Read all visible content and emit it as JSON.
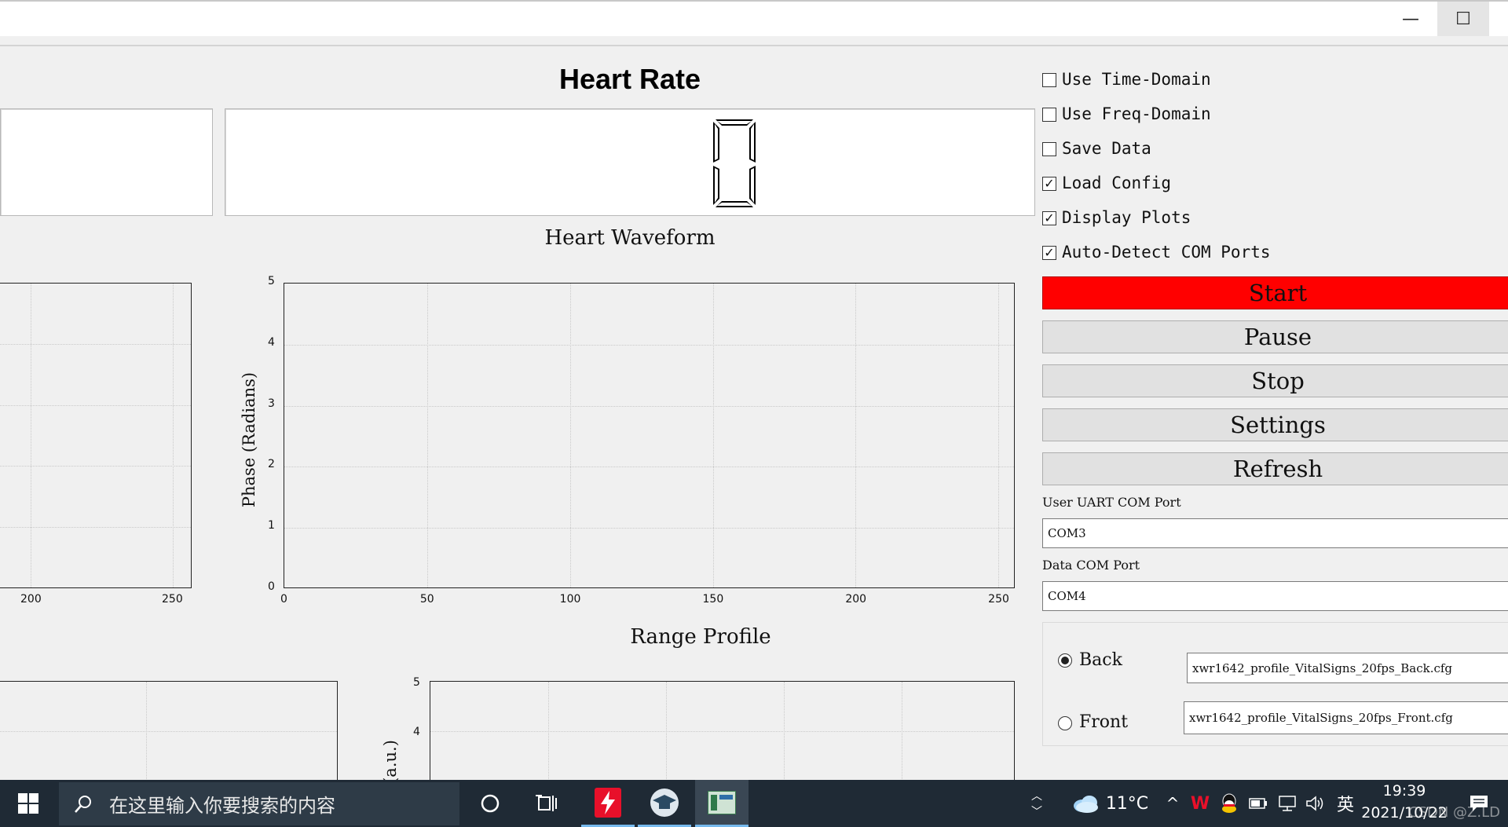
{
  "window": {
    "minimize_glyph": "—",
    "maximize_glyph": "☐"
  },
  "heart_rate": {
    "title": "Heart Rate",
    "value": "0"
  },
  "heart_waveform": {
    "title": "Heart Waveform",
    "ylabel": "Phase (Radians)"
  },
  "left_plot": {
    "x_ticks": [
      "200",
      "250"
    ]
  },
  "range_profile": {
    "title": "Range Profile",
    "ylabel_fragment": "(a.u.)",
    "y_ticks": [
      "5",
      "4"
    ]
  },
  "chart_data": {
    "type": "line",
    "title": "Heart Waveform",
    "xlabel": "",
    "ylabel": "Phase (Radians)",
    "x_ticks": [
      0,
      50,
      100,
      150,
      200,
      250
    ],
    "y_ticks": [
      0,
      1,
      2,
      3,
      4,
      5
    ],
    "xlim": [
      0,
      256
    ],
    "ylim": [
      0,
      5
    ],
    "grid": true,
    "series": []
  },
  "options": [
    {
      "label": "Use Time-Domain",
      "checked": false
    },
    {
      "label": "Use Freq-Domain",
      "checked": false
    },
    {
      "label": "Save Data",
      "checked": false
    },
    {
      "label": "Load Config",
      "checked": true
    },
    {
      "label": "Display Plots",
      "checked": true
    },
    {
      "label": "Auto-Detect COM Ports",
      "checked": true
    }
  ],
  "buttons": {
    "start": "Start",
    "pause": "Pause",
    "stop": "Stop",
    "settings": "Settings",
    "refresh": "Refresh"
  },
  "colors": {
    "start_button": "#ff0000"
  },
  "com": {
    "uart_label": "User UART COM Port",
    "uart_value": "COM3",
    "data_label": "Data COM Port",
    "data_value": "COM4"
  },
  "config": {
    "back_label": "Back",
    "back_file": "xwr1642_profile_VitalSigns_20fps_Back.cfg",
    "back_selected": true,
    "front_label": "Front",
    "front_file": "xwr1642_profile_VitalSigns_20fps_Front.cfg",
    "front_selected": false
  },
  "taskbar": {
    "search_placeholder": "在这里输入你要搜索的内容",
    "weather": "11°C",
    "ime": "英",
    "time": "19:39",
    "date": "2021/10/22",
    "watermark": "CSDN @Z.LD"
  }
}
